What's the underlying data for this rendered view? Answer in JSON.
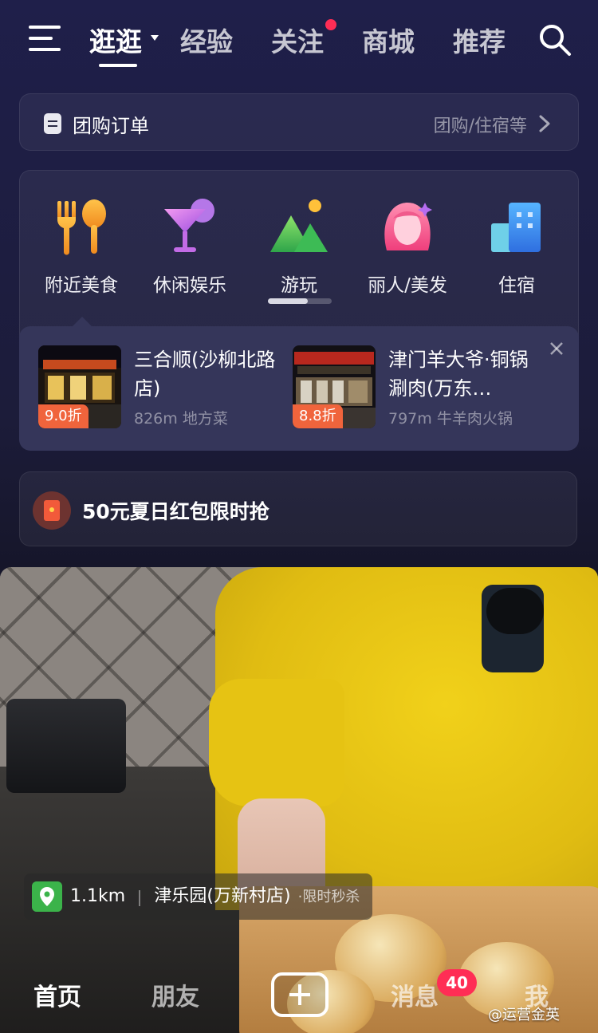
{
  "top_nav": {
    "tabs": [
      {
        "label": "逛逛",
        "active": true
      },
      {
        "label": "经验"
      },
      {
        "label": "关注",
        "has_dot": true
      },
      {
        "label": "商城"
      },
      {
        "label": "推荐"
      }
    ],
    "icons": {
      "menu": "menu-icon",
      "search": "search-icon",
      "dropdown": "caret-down-icon"
    }
  },
  "group_order": {
    "title": "团购订单",
    "subtitle": "团购/住宿等",
    "icon": "order-icon"
  },
  "categories": [
    {
      "label": "附近美食",
      "icon": "fork-spoon-icon"
    },
    {
      "label": "休闲娱乐",
      "icon": "cocktail-icon"
    },
    {
      "label": "游玩",
      "icon": "mountain-icon"
    },
    {
      "label": "丽人/美发",
      "icon": "woman-hair-icon"
    },
    {
      "label": "住宿",
      "icon": "hotel-building-icon"
    }
  ],
  "pager": {
    "page": 1,
    "pages": 2
  },
  "recommendations": [
    {
      "name": "三合顺(沙柳北路店)",
      "distance": "826m",
      "category": "地方菜",
      "discount": "9.0折"
    },
    {
      "name": "津门羊大爷·铜锅涮肉(万东…",
      "distance": "797m",
      "category": "牛羊肉火锅",
      "discount": "8.8折"
    }
  ],
  "red_packet": {
    "text": "50元夏日红包限时抢",
    "icon": "red-envelope-icon"
  },
  "video_location": {
    "distance": "1.1km",
    "shop": "津乐园(万新村店)",
    "tag": "·限时秒杀",
    "icon": "location-pin-icon"
  },
  "bottom_tabs": {
    "home": "首页",
    "friends": "朋友",
    "messages": "消息",
    "me": "我",
    "message_badge": "40"
  },
  "watermark": "@运营金英",
  "colors": {
    "accent_red": "#ff2d55",
    "discount_orange": "#f0643c",
    "location_green": "#3bb34a"
  }
}
